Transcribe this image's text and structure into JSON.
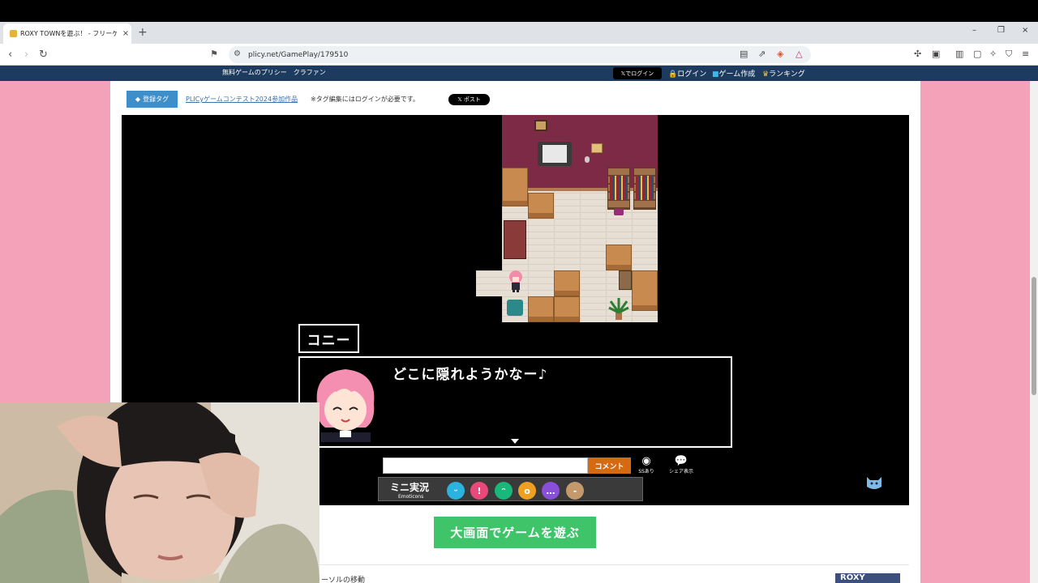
{
  "browser": {
    "tab_title": "ROXY TOWNを遊ぶ！ - フリーゲ",
    "tab_close": "×",
    "new_tab": "+",
    "url": "plicy.net/GamePlay/179510",
    "window_controls": [
      "–",
      "❐",
      "×"
    ]
  },
  "site_header": {
    "brand": "無料ゲームのプリシー　クラファン",
    "x_login": "𝕏でログイン",
    "links": [
      "ログイン",
      "ゲーム作成",
      "ランキング"
    ]
  },
  "tags": {
    "button_label": "登録タグ",
    "tag_link": "PLICyゲームコンテスト2024参加作品",
    "note": "※タグ編集にはログインが必要です。",
    "post_button": "𝕏 ポスト"
  },
  "game": {
    "speaker_name": "コニー",
    "dialogue": "どこに隠れようかなー♪"
  },
  "comment_bar": {
    "button_label": "コメント",
    "ss_label": "SSあり",
    "share_label": "シェア表示"
  },
  "mini_jikkyo": {
    "label": "ミニ実況",
    "sublabel": "Emoticons",
    "emoticons": [
      {
        "icon": "happy-face",
        "color": "#2bb3e0",
        "glyph": "ᵕ"
      },
      {
        "icon": "angry-face",
        "color": "#e8487a",
        "glyph": "!"
      },
      {
        "icon": "laugh-face",
        "color": "#1ab77a",
        "glyph": "ᵔ"
      },
      {
        "icon": "surprised-face",
        "color": "#f0a020",
        "glyph": "o"
      },
      {
        "icon": "sad-face",
        "color": "#8a4fd8",
        "glyph": "…"
      },
      {
        "icon": "neutral-face",
        "color": "#c49a6c",
        "glyph": "-"
      }
    ]
  },
  "play_big_button": "大画面でゲームを遊ぶ",
  "below_text": "ーソルの移動",
  "roxy_logo": "ROXY"
}
